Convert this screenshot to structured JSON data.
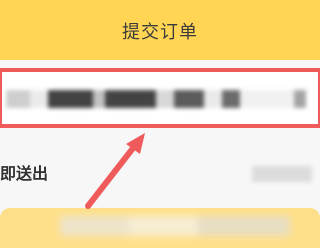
{
  "header": {
    "title": "提交订单"
  },
  "address": {
    "text": ""
  },
  "delivery": {
    "label": "即送出",
    "value": ""
  },
  "annotation": {
    "accent": "#ef5a5a",
    "icon": "red-arrow-icon"
  },
  "colors": {
    "brand": "#ffd553",
    "highlight": "#ef5a5a"
  }
}
